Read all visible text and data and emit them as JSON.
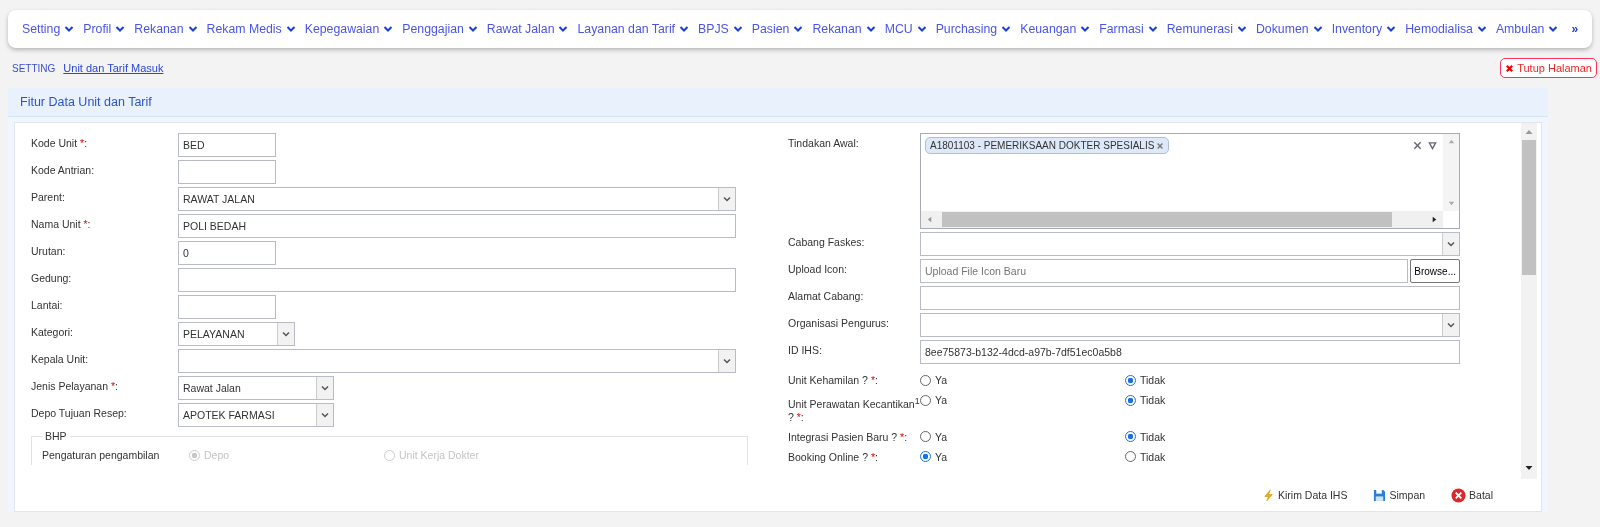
{
  "nav": {
    "items": [
      {
        "label": "Setting"
      },
      {
        "label": "Profil"
      },
      {
        "label": "Rekanan"
      },
      {
        "label": "Rekam Medis"
      },
      {
        "label": "Kepegawaian"
      },
      {
        "label": "Penggajian"
      },
      {
        "label": "Rawat Jalan"
      },
      {
        "label": "Layanan dan Tarif"
      },
      {
        "label": "BPJS"
      },
      {
        "label": "Pasien"
      },
      {
        "label": "Rekanan"
      },
      {
        "label": "MCU"
      },
      {
        "label": "Purchasing"
      },
      {
        "label": "Keuangan"
      },
      {
        "label": "Farmasi"
      },
      {
        "label": "Remunerasi"
      },
      {
        "label": "Dokumen"
      },
      {
        "label": "Inventory"
      },
      {
        "label": "Hemodialisa"
      },
      {
        "label": "Ambulan"
      }
    ],
    "more": "»"
  },
  "breadcrumb": {
    "section": "SETTING",
    "page": "Unit dan Tarif Masuk"
  },
  "close_button": "Tutup Halaman",
  "panel": {
    "title": "Fitur Data Unit dan Tarif"
  },
  "left_fields": [
    {
      "label": "Kode Unit ",
      "required_mark": "*",
      "suffix": ":",
      "kind": "text",
      "value": "BED"
    },
    {
      "label": "Kode Antrian:",
      "kind": "text"
    },
    {
      "label": "Parent:",
      "kind": "select",
      "value": "RAWAT JALAN"
    },
    {
      "label": "Nama Unit ",
      "required_mark": "*",
      "suffix": ":",
      "kind": "text",
      "value": "POLI BEDAH"
    },
    {
      "label": "Urutan:",
      "kind": "text",
      "value": "0"
    },
    {
      "label": "Gedung:",
      "kind": "text"
    },
    {
      "label": "Lantai:",
      "kind": "text"
    },
    {
      "label": "Kategori:",
      "kind": "select",
      "value": "PELAYANAN"
    },
    {
      "label": "Kepala Unit:",
      "kind": "select"
    },
    {
      "label": "Jenis Pelayanan ",
      "required_mark": "*",
      "suffix": ":",
      "kind": "select",
      "value": "Rawat Jalan"
    },
    {
      "label": "Depo Tujuan Resep:",
      "kind": "select",
      "value": "APOTEK FARMASI"
    }
  ],
  "bhp": {
    "legend": "BHP",
    "label": "Pengaturan pengambilan",
    "disabled": true,
    "options": [
      {
        "label": "Depo",
        "selected": true
      },
      {
        "label": "Unit Kerja Dokter",
        "selected": false
      }
    ]
  },
  "tindakan_awal": {
    "label": "Tindakan Awal:",
    "tags": [
      "A1801103 - PEMERIKSAAN DOKTER SPESIALIS"
    ]
  },
  "right_fields": [
    {
      "label": "Cabang Faskes:",
      "kind": "select"
    },
    {
      "label": "Upload Icon:",
      "kind": "file",
      "placeholder": "Upload File Icon Baru",
      "button": "Browse..."
    },
    {
      "label": "Alamat Cabang:",
      "kind": "text"
    },
    {
      "label": "Organisasi Pengurus:",
      "kind": "select"
    },
    {
      "label": "ID IHS:",
      "kind": "text",
      "value": "8ee75873-b132-4dcd-a97b-7df51ec0a5b8"
    }
  ],
  "radio_fields": [
    {
      "label": "Unit Kehamilan ? ",
      "required_mark": "*",
      "suffix": ":",
      "options": [
        {
          "label": "Ya",
          "selected": false
        },
        {
          "label": "Tidak",
          "selected": true
        }
      ]
    },
    {
      "label": "Unit Perawatan Kecantikan$^{1}$ ? ",
      "required_mark": "*",
      "suffix": ":",
      "options": [
        {
          "label": "Ya",
          "selected": false
        },
        {
          "label": "Tidak",
          "selected": true
        }
      ]
    },
    {
      "label": "Integrasi Pasien Baru ? ",
      "required_mark": "*",
      "suffix": ":",
      "options": [
        {
          "label": "Ya",
          "selected": false
        },
        {
          "label": "Tidak",
          "selected": true
        }
      ]
    },
    {
      "label": "Booking Online ? ",
      "required_mark": "*",
      "suffix": ":",
      "options": [
        {
          "label": "Ya",
          "selected": true
        },
        {
          "label": "Tidak",
          "selected": false
        }
      ]
    }
  ],
  "footer_buttons": [
    {
      "label": "Kirim Data IHS",
      "kind": "ihs"
    },
    {
      "label": "Simpan",
      "kind": "save"
    },
    {
      "label": "Batal",
      "kind": "cancel"
    }
  ]
}
